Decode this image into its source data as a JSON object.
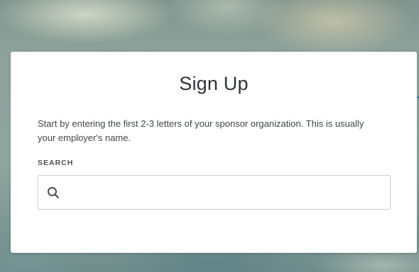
{
  "signup": {
    "title": "Sign Up",
    "description": "Start by entering the first 2-3 letters of your sponsor organization. This is usually your employer's name.",
    "search_label": "SEARCH",
    "search_value": "",
    "search_placeholder": ""
  },
  "icons": {
    "search": "search-icon"
  },
  "colors": {
    "card_background": "#ffffff",
    "title_text": "#2d3338",
    "body_text": "#3f464c",
    "input_border": "#c9cdd1",
    "accent_line": "#2f6db0"
  }
}
